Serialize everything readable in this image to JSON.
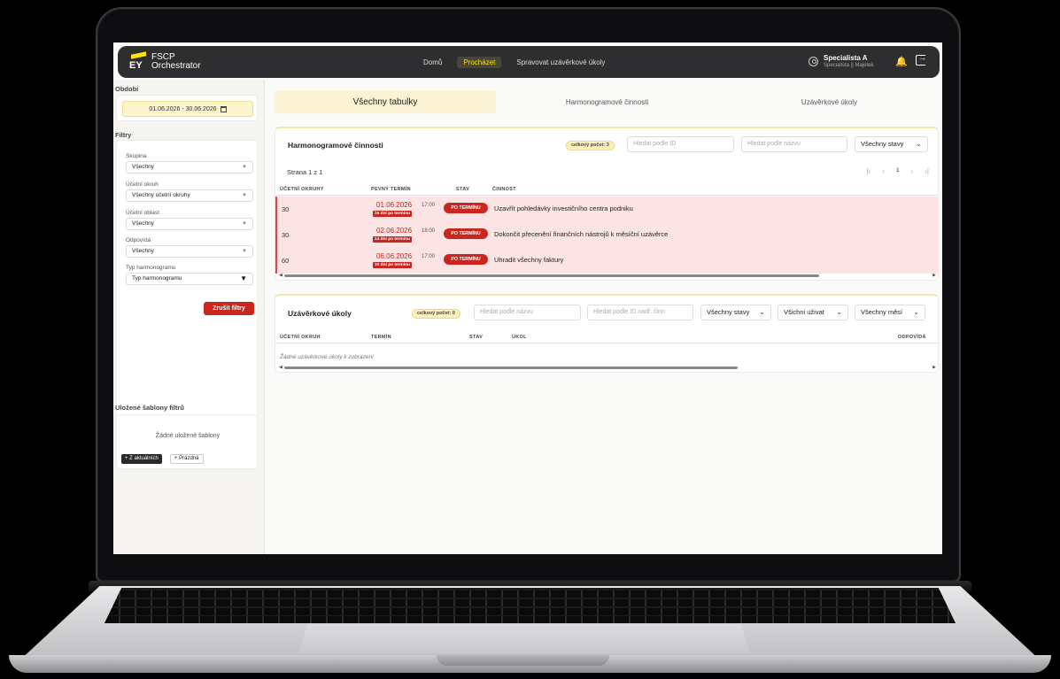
{
  "app": {
    "brand_line1": "FSCP",
    "brand_line2": "Orchestrator",
    "logo_text": "EY",
    "nav": [
      "Domů",
      "Procházet",
      "Spravovat uzávěrkové úkoly"
    ],
    "active_nav": "Procházet",
    "user_name": "Specialista A",
    "user_role": "Specialista || Majetek",
    "bell_icon": "bell-icon",
    "logout_icon": "logout-icon"
  },
  "sidebar": {
    "period_label": "Období",
    "period_value": "01.06.2026 - 30.06.2026",
    "filters_label": "Filtry",
    "filters": [
      {
        "label": "Skupina",
        "value": "Všechny"
      },
      {
        "label": "Účetní okruh",
        "value": "Všechny účetní okruhy"
      },
      {
        "label": "Účetní oblast",
        "value": "Všechny"
      },
      {
        "label": "Odpovídá",
        "value": "Všechny"
      },
      {
        "label": "Typ harmonogramu",
        "value": "Typ harmonogramu"
      }
    ],
    "clear_button": "Zrušit filtry",
    "saved_label": "Uložené šablony filtrů",
    "saved_empty": "Žádné uložené šablony",
    "btn_from_current": "+ Z aktuálních",
    "btn_empty": "+ Prázdná"
  },
  "tabs": [
    "Všechny tabulky",
    "Harmonogramové činnosti",
    "Uzávěrkové úkoly"
  ],
  "schedule": {
    "title": "Harmonogramové činnosti",
    "count": "celkový počet: 3",
    "search_id": "Hledat podle ID",
    "search_name": "Hledat podle názvu",
    "status_filter": "Všechny stavy",
    "pager_text": "Strana 1 z 1",
    "page": "1",
    "columns": [
      "ÚČETNÍ OKRUHY",
      "PEVNÝ TERMÍN",
      "STAV",
      "ČINNOST"
    ],
    "rows": [
      {
        "okruh": "30",
        "date": "01.06.2026",
        "time": "17:00",
        "overdue": "15 dní po termínu",
        "status": "PO TERMÍNU",
        "activity": "Uzavřít pohledávky investičního centra podniku"
      },
      {
        "okruh": "30",
        "date": "02.06.2026",
        "time": "18:00",
        "overdue": "14 dní po termínu",
        "status": "PO TERMÍNU",
        "activity": "Dokončit přecenění finančních nástrojů k měsíční uzávěrce"
      },
      {
        "okruh": "60",
        "date": "06.06.2026",
        "time": "17:00",
        "overdue": "10 dní po termínu",
        "status": "PO TERMÍNU",
        "activity": "Uhradit všechny faktury"
      }
    ]
  },
  "closing": {
    "title": "Uzávěrkové úkoly",
    "count": "celkový počet: 0",
    "search_name": "Hledat podle názvu",
    "search_parent": "Hledat podle ID nadř. činn",
    "status_filter": "Všechny stavy",
    "user_filter": "Všichni uživat",
    "month_filter": "Všechny měsí",
    "columns": [
      "ÚČETNÍ OKRUH",
      "TERMÍN",
      "STAV",
      "ÚKOL",
      "ODPOVÍDÁ"
    ],
    "empty": "Žádné uzávěrkové úkoly k zobrazení"
  }
}
